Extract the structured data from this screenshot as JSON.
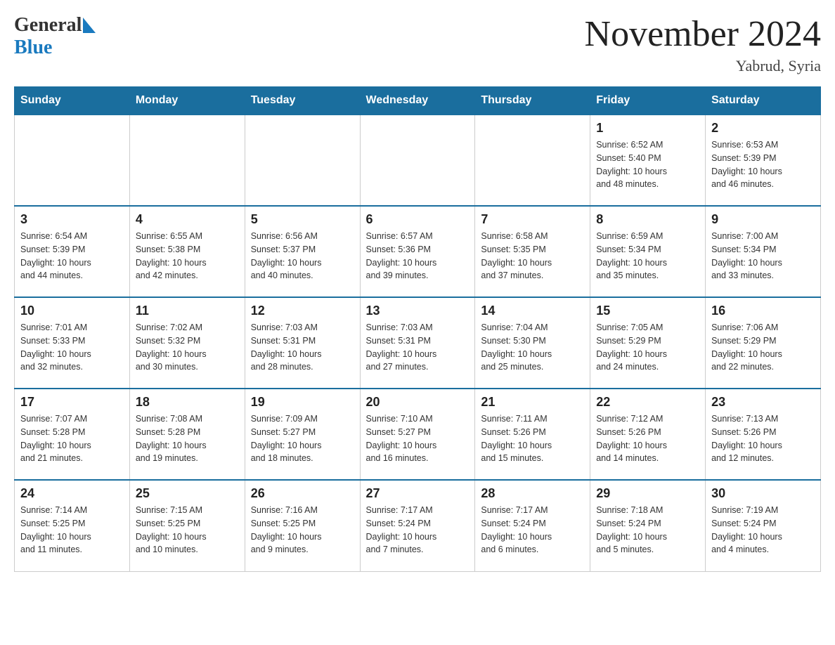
{
  "logo": {
    "text_general": "General",
    "triangle": "▶",
    "text_blue": "Blue"
  },
  "title": "November 2024",
  "subtitle": "Yabrud, Syria",
  "days_of_week": [
    "Sunday",
    "Monday",
    "Tuesday",
    "Wednesday",
    "Thursday",
    "Friday",
    "Saturday"
  ],
  "weeks": [
    [
      {
        "day": "",
        "info": ""
      },
      {
        "day": "",
        "info": ""
      },
      {
        "day": "",
        "info": ""
      },
      {
        "day": "",
        "info": ""
      },
      {
        "day": "",
        "info": ""
      },
      {
        "day": "1",
        "info": "Sunrise: 6:52 AM\nSunset: 5:40 PM\nDaylight: 10 hours\nand 48 minutes."
      },
      {
        "day": "2",
        "info": "Sunrise: 6:53 AM\nSunset: 5:39 PM\nDaylight: 10 hours\nand 46 minutes."
      }
    ],
    [
      {
        "day": "3",
        "info": "Sunrise: 6:54 AM\nSunset: 5:39 PM\nDaylight: 10 hours\nand 44 minutes."
      },
      {
        "day": "4",
        "info": "Sunrise: 6:55 AM\nSunset: 5:38 PM\nDaylight: 10 hours\nand 42 minutes."
      },
      {
        "day": "5",
        "info": "Sunrise: 6:56 AM\nSunset: 5:37 PM\nDaylight: 10 hours\nand 40 minutes."
      },
      {
        "day": "6",
        "info": "Sunrise: 6:57 AM\nSunset: 5:36 PM\nDaylight: 10 hours\nand 39 minutes."
      },
      {
        "day": "7",
        "info": "Sunrise: 6:58 AM\nSunset: 5:35 PM\nDaylight: 10 hours\nand 37 minutes."
      },
      {
        "day": "8",
        "info": "Sunrise: 6:59 AM\nSunset: 5:34 PM\nDaylight: 10 hours\nand 35 minutes."
      },
      {
        "day": "9",
        "info": "Sunrise: 7:00 AM\nSunset: 5:34 PM\nDaylight: 10 hours\nand 33 minutes."
      }
    ],
    [
      {
        "day": "10",
        "info": "Sunrise: 7:01 AM\nSunset: 5:33 PM\nDaylight: 10 hours\nand 32 minutes."
      },
      {
        "day": "11",
        "info": "Sunrise: 7:02 AM\nSunset: 5:32 PM\nDaylight: 10 hours\nand 30 minutes."
      },
      {
        "day": "12",
        "info": "Sunrise: 7:03 AM\nSunset: 5:31 PM\nDaylight: 10 hours\nand 28 minutes."
      },
      {
        "day": "13",
        "info": "Sunrise: 7:03 AM\nSunset: 5:31 PM\nDaylight: 10 hours\nand 27 minutes."
      },
      {
        "day": "14",
        "info": "Sunrise: 7:04 AM\nSunset: 5:30 PM\nDaylight: 10 hours\nand 25 minutes."
      },
      {
        "day": "15",
        "info": "Sunrise: 7:05 AM\nSunset: 5:29 PM\nDaylight: 10 hours\nand 24 minutes."
      },
      {
        "day": "16",
        "info": "Sunrise: 7:06 AM\nSunset: 5:29 PM\nDaylight: 10 hours\nand 22 minutes."
      }
    ],
    [
      {
        "day": "17",
        "info": "Sunrise: 7:07 AM\nSunset: 5:28 PM\nDaylight: 10 hours\nand 21 minutes."
      },
      {
        "day": "18",
        "info": "Sunrise: 7:08 AM\nSunset: 5:28 PM\nDaylight: 10 hours\nand 19 minutes."
      },
      {
        "day": "19",
        "info": "Sunrise: 7:09 AM\nSunset: 5:27 PM\nDaylight: 10 hours\nand 18 minutes."
      },
      {
        "day": "20",
        "info": "Sunrise: 7:10 AM\nSunset: 5:27 PM\nDaylight: 10 hours\nand 16 minutes."
      },
      {
        "day": "21",
        "info": "Sunrise: 7:11 AM\nSunset: 5:26 PM\nDaylight: 10 hours\nand 15 minutes."
      },
      {
        "day": "22",
        "info": "Sunrise: 7:12 AM\nSunset: 5:26 PM\nDaylight: 10 hours\nand 14 minutes."
      },
      {
        "day": "23",
        "info": "Sunrise: 7:13 AM\nSunset: 5:26 PM\nDaylight: 10 hours\nand 12 minutes."
      }
    ],
    [
      {
        "day": "24",
        "info": "Sunrise: 7:14 AM\nSunset: 5:25 PM\nDaylight: 10 hours\nand 11 minutes."
      },
      {
        "day": "25",
        "info": "Sunrise: 7:15 AM\nSunset: 5:25 PM\nDaylight: 10 hours\nand 10 minutes."
      },
      {
        "day": "26",
        "info": "Sunrise: 7:16 AM\nSunset: 5:25 PM\nDaylight: 10 hours\nand 9 minutes."
      },
      {
        "day": "27",
        "info": "Sunrise: 7:17 AM\nSunset: 5:24 PM\nDaylight: 10 hours\nand 7 minutes."
      },
      {
        "day": "28",
        "info": "Sunrise: 7:17 AM\nSunset: 5:24 PM\nDaylight: 10 hours\nand 6 minutes."
      },
      {
        "day": "29",
        "info": "Sunrise: 7:18 AM\nSunset: 5:24 PM\nDaylight: 10 hours\nand 5 minutes."
      },
      {
        "day": "30",
        "info": "Sunrise: 7:19 AM\nSunset: 5:24 PM\nDaylight: 10 hours\nand 4 minutes."
      }
    ]
  ]
}
